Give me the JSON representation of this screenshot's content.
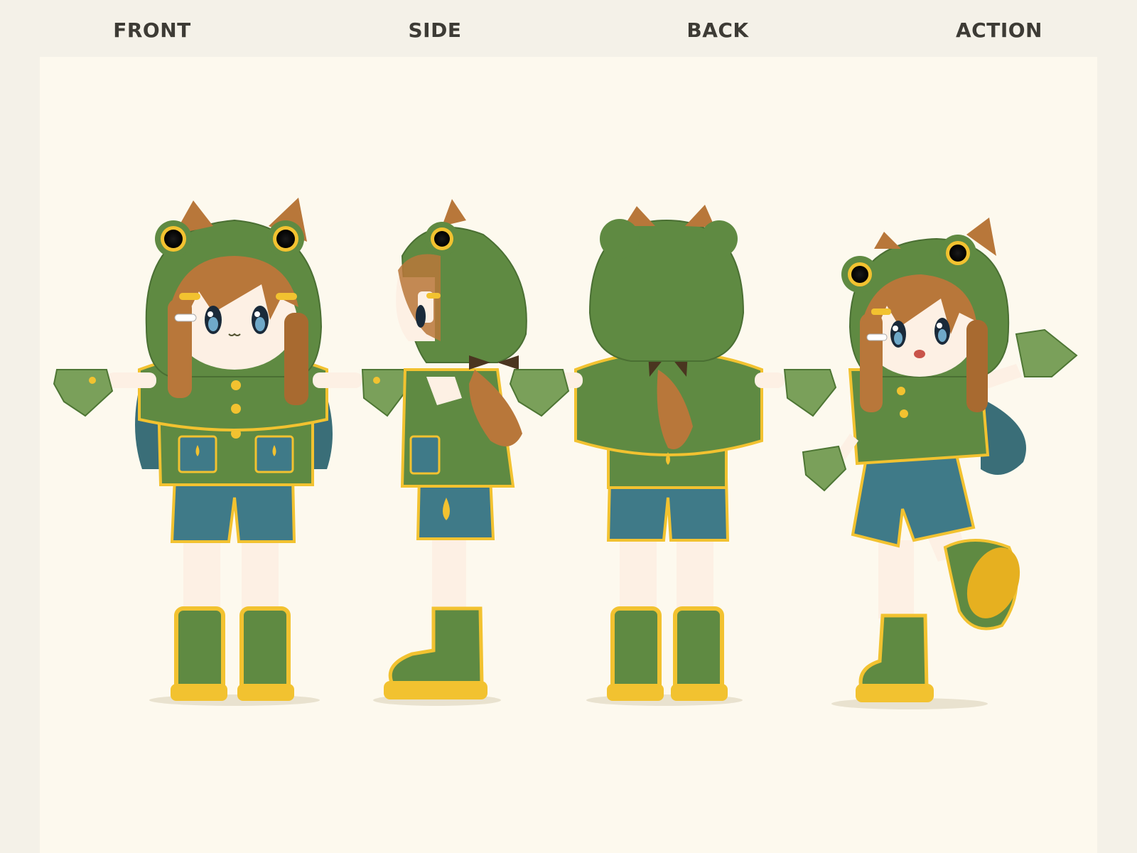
{
  "views": {
    "front": "FRONT",
    "side": "SIDE",
    "back": "BACK",
    "action": "ACTION"
  },
  "colors": {
    "page_bg": "#f4f1e8",
    "canvas_bg": "#fdf9ee",
    "hood_green": "#5f8a42",
    "trim_yellow": "#f2c230",
    "shorts_blue": "#3f7a88",
    "hair_brown": "#b8773a",
    "skin": "#fdf0e4",
    "label_text": "#3d3b35"
  },
  "icons": {
    "front_figure": "frog-hood-character-front",
    "side_figure": "frog-hood-character-side",
    "back_figure": "frog-hood-character-back",
    "action_figure": "frog-hood-character-action"
  }
}
